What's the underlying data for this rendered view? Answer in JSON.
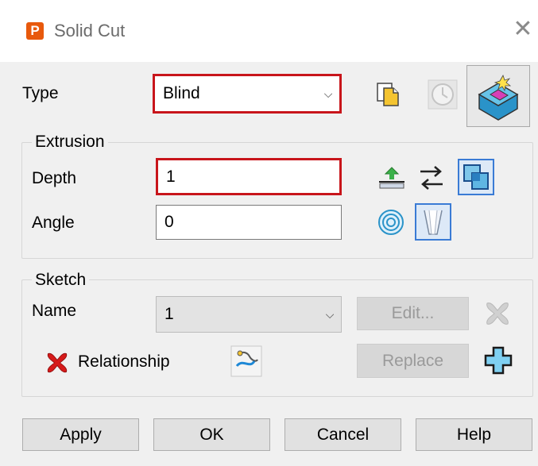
{
  "window": {
    "title": "Solid Cut",
    "app_icon_letter": "P",
    "close_glyph": "✕"
  },
  "type": {
    "label": "Type",
    "value": "Blind"
  },
  "extrusion": {
    "group_label": "Extrusion",
    "depth_label": "Depth",
    "depth_value": "1",
    "angle_label": "Angle",
    "angle_value": "0"
  },
  "sketch": {
    "group_label": "Sketch",
    "name_label": "Name",
    "name_value": "1",
    "edit_button": "Edit...",
    "relationship_label": "Relationship",
    "replace_button": "Replace"
  },
  "footer": {
    "apply": "Apply",
    "ok": "OK",
    "cancel": "Cancel",
    "help": "Help"
  },
  "icons": [
    "copy-icon",
    "history-clock-icon",
    "solid-cut-icon",
    "extrude-direction-icon",
    "swap-direction-icon",
    "boolean-overlap-icon",
    "concentric-circles-icon",
    "draft-angle-icon",
    "delete-sketch-icon",
    "relationship-error-icon",
    "sketch-link-icon",
    "add-sketch-icon"
  ],
  "colors": {
    "error_red": "#c8151b",
    "highlight_blue": "#3a7bd5",
    "accent_orange": "#e8590c"
  }
}
